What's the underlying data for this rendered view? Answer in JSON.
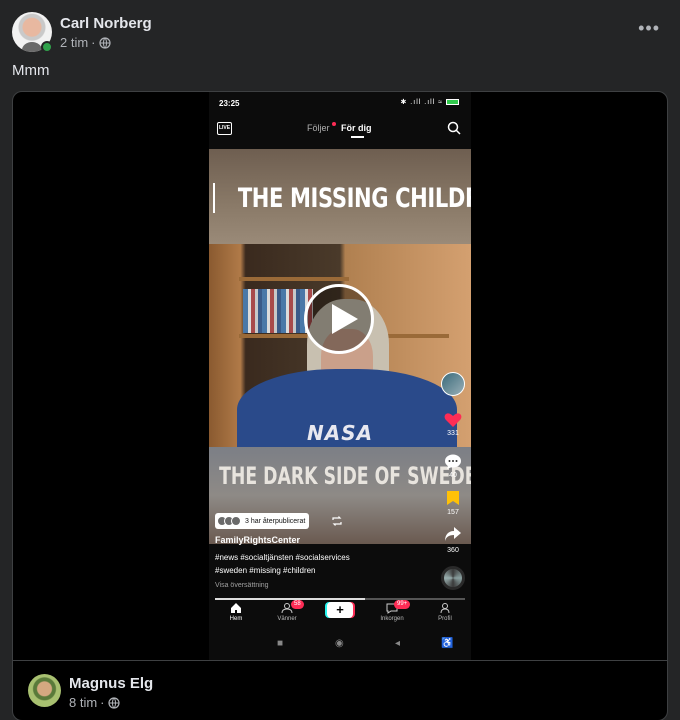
{
  "post": {
    "author": "Carl Norberg",
    "time": "2 tim",
    "separator": "·",
    "more_label": "•••",
    "text": "Mmm"
  },
  "phone": {
    "status_time": "23:25",
    "status_icons": "✱ .ıll .ıll ≈",
    "live_label": "LIVE",
    "tab_following": "Följer",
    "tab_for_you": "För dig",
    "video_title_top": "THE MISSING CHILDREN",
    "video_title_bottom": "THE DARK SIDE OF SWEDEN",
    "shirt_text": "NASA",
    "like_count": "331",
    "comment_count": "40",
    "bookmark_count": "157",
    "share_count": "360",
    "repost_text": "3 har återpublicerat",
    "username": "FamilyRightsCenter",
    "caption_line1": "#news #socialtjänsten #socialservices",
    "caption_line2": "#sweden #missing #children",
    "translate_label": "Visa översättning",
    "progress": 0.6,
    "nav": [
      {
        "label": "Hem",
        "badge": ""
      },
      {
        "label": "Vänner",
        "badge": "58"
      },
      {
        "label": "",
        "badge": ""
      },
      {
        "label": "Inkorgen",
        "badge": "99+"
      },
      {
        "label": "Profil",
        "badge": ""
      }
    ],
    "plus_label": "+"
  },
  "comment": {
    "author": "Magnus Elg",
    "time": "8 tim",
    "separator": "·"
  },
  "colors": {
    "background": "#242526",
    "accent_red": "#fe2c55",
    "online_green": "#31a24c",
    "bookmark_yellow": "#ffc107"
  }
}
